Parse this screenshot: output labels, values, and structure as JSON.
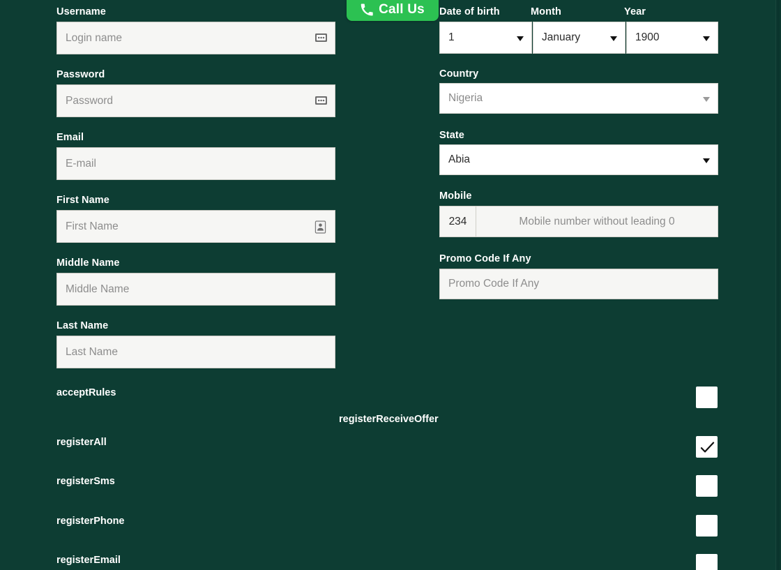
{
  "theme": {
    "page_bg": "#0d3d33",
    "input_bg": "#f6f6f4",
    "select_bg": "#ffffff",
    "label_color": "#ffffff",
    "placeholder_color": "#8d8d8d",
    "accent_green": "#2cc152"
  },
  "floating": {
    "call_us": {
      "label": "Call Us",
      "icon": "phone-icon"
    }
  },
  "form": {
    "left_column": [
      {
        "id": "username",
        "label": "Username",
        "placeholder": "Login name",
        "value": "",
        "icon": "password-manager-icon"
      },
      {
        "id": "password",
        "label": "Password",
        "placeholder": "Password",
        "value": "",
        "icon": "password-manager-icon"
      },
      {
        "id": "email",
        "label": "Email",
        "placeholder": "E-mail",
        "value": "",
        "icon": ""
      },
      {
        "id": "first-name",
        "label": "First Name",
        "placeholder": "First Name",
        "value": "",
        "icon": "contact-card-icon"
      },
      {
        "id": "middle-name",
        "label": "Middle Name",
        "placeholder": "Middle Name",
        "value": "",
        "icon": ""
      },
      {
        "id": "last-name",
        "label": "Last Name",
        "placeholder": "Last Name",
        "value": "",
        "icon": ""
      }
    ],
    "date_of_birth": {
      "day": {
        "label": "Date of birth",
        "value": "1"
      },
      "month": {
        "label": "Month",
        "value": "January"
      },
      "year": {
        "label": "Year",
        "value": "1900"
      }
    },
    "country": {
      "label": "Country",
      "value": "Nigeria"
    },
    "state": {
      "label": "State",
      "value": "Abia"
    },
    "mobile": {
      "label": "Mobile",
      "prefix": "234",
      "placeholder": "Mobile number without leading 0",
      "value": ""
    },
    "promo": {
      "label": "Promo Code If Any",
      "placeholder": "Promo Code If Any",
      "value": ""
    }
  },
  "consents": {
    "accept_rules": {
      "label": "acceptRules",
      "checked": false
    },
    "receive_offer_heading": "registerReceiveOffer",
    "options": [
      {
        "label": "registerAll",
        "checked": true
      },
      {
        "label": "registerSms",
        "checked": false
      },
      {
        "label": "registerPhone",
        "checked": false
      },
      {
        "label": "registerEmail",
        "checked": false
      }
    ]
  }
}
